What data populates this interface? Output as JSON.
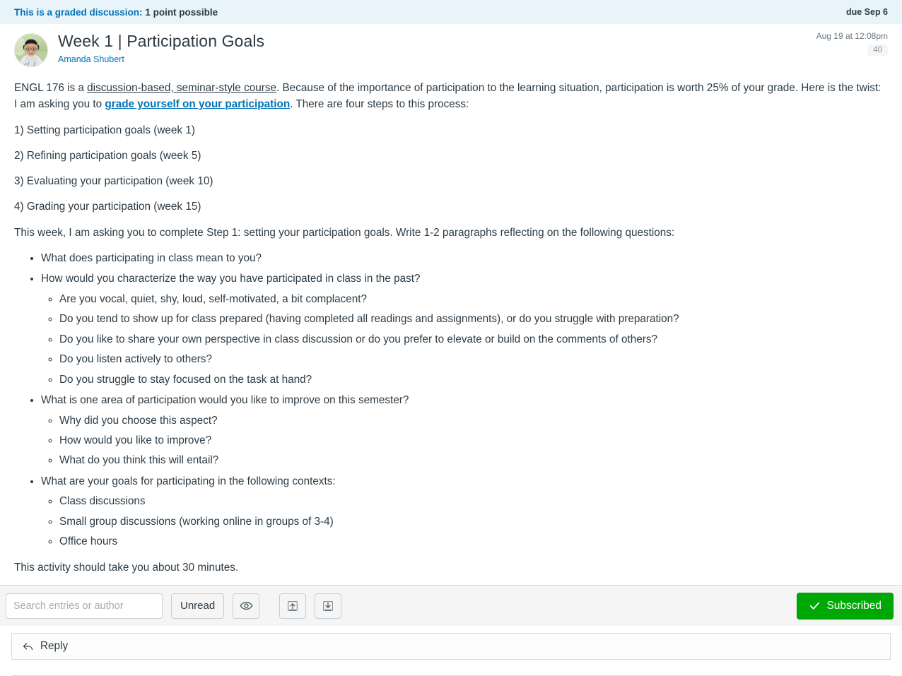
{
  "banner": {
    "lead": "This is a graded discussion:",
    "points": "1 point possible",
    "due": "due Sep 6"
  },
  "post": {
    "title": "Week 1 | Participation Goals",
    "author": "Amanda Shubert",
    "date": "Aug 19 at 12:08pm",
    "unread_count": "40",
    "avatar_icon": "user-avatar-photo"
  },
  "message": {
    "intro_1": "ENGL 176 is a ",
    "intro_underlined": "discussion-based, seminar-style course",
    "intro_2": ". Because of the importance of participation to the learning situation, participation is worth 25% of your grade. Here is the twist: I am asking you to ",
    "intro_link": "grade yourself on your participation",
    "intro_3": ". There are four steps to this process:",
    "steps": [
      "1) Setting participation goals (week 1)",
      "2) Refining participation goals (week 5)",
      "3) Evaluating your participation (week 10)",
      "4) Grading your participation (week 15)"
    ],
    "prompt": "This week, I am asking you to complete Step 1: setting your participation goals. Write 1-2 paragraphs reflecting on the following questions:",
    "questions": [
      {
        "text": "What does participating in class mean to you?",
        "sub": []
      },
      {
        "text": "How would you characterize the way you have participated in class in the past?",
        "sub": [
          "Are you vocal, quiet, shy, loud, self-motivated, a bit complacent?",
          "Do you tend to show up for class prepared (having completed all readings and assignments), or do you struggle with preparation?",
          "Do you like to share your own perspective in class discussion or do you prefer to elevate or build on the comments of others?",
          "Do you listen actively to others?",
          "Do you struggle to stay focused on the task at hand?"
        ]
      },
      {
        "text": "What is one area of participation would you like to improve on this semester?",
        "sub": [
          "Why did you choose this aspect?",
          "How would you like to improve?",
          "What do you think this will entail?"
        ]
      },
      {
        "text": "What are your goals for participating in the following contexts:",
        "sub": [
          "Class discussions",
          "Small group discussions (working online in groups of 3-4)",
          "Office hours"
        ]
      }
    ],
    "closing": "This activity should take you about 30 minutes."
  },
  "toolbar": {
    "search_placeholder": "Search entries or author",
    "search_value": "",
    "unread_label": "Unread",
    "mark_all_read_icon": "eye-icon",
    "collapse_threads_icon": "collapse-up-icon",
    "expand_threads_icon": "expand-down-icon",
    "subscribe_label": "Subscribed",
    "subscribe_icon": "check-icon",
    "subscribe_color": "#00A806"
  },
  "reply": {
    "label": "Reply",
    "icon": "reply-arrow-icon"
  }
}
